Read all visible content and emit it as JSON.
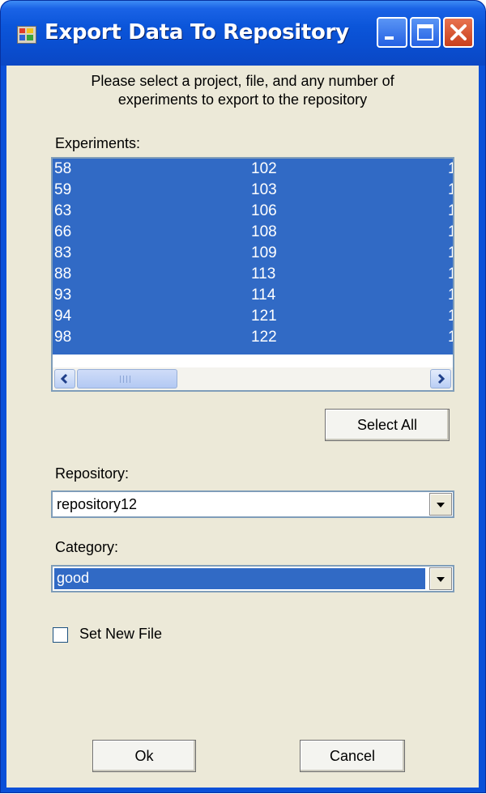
{
  "window": {
    "title": "Export Data To Repository",
    "icon": "app-window-icon"
  },
  "dialog": {
    "instructions_line1": "Please select a project, file, and any number of",
    "instructions_line2": "experiments to export to the repository"
  },
  "experiments": {
    "label": "Experiments:",
    "rows": [
      {
        "col1": "58",
        "col2": "102",
        "col3": "1"
      },
      {
        "col1": "59",
        "col2": "103",
        "col3": "1"
      },
      {
        "col1": "63",
        "col2": "106",
        "col3": "1"
      },
      {
        "col1": "66",
        "col2": "108",
        "col3": "1"
      },
      {
        "col1": "83",
        "col2": "109",
        "col3": "1"
      },
      {
        "col1": "88",
        "col2": "113",
        "col3": "1"
      },
      {
        "col1": "93",
        "col2": "114",
        "col3": "1"
      },
      {
        "col1": "94",
        "col2": "121",
        "col3": "1"
      },
      {
        "col1": "98",
        "col2": "122",
        "col3": "1"
      }
    ],
    "select_all_label": "Select All"
  },
  "repository": {
    "label": "Repository:",
    "selected_value": "repository12"
  },
  "category": {
    "label": "Category:",
    "selected_value": "good"
  },
  "set_new_file": {
    "label": "Set New File",
    "checked": false
  },
  "buttons": {
    "ok_label": "Ok",
    "cancel_label": "Cancel"
  },
  "colors": {
    "titlebar": "#0a4ed0",
    "selection": "#316ac5",
    "dialog_bg": "#ece9d8",
    "close_button": "#c9401d"
  }
}
